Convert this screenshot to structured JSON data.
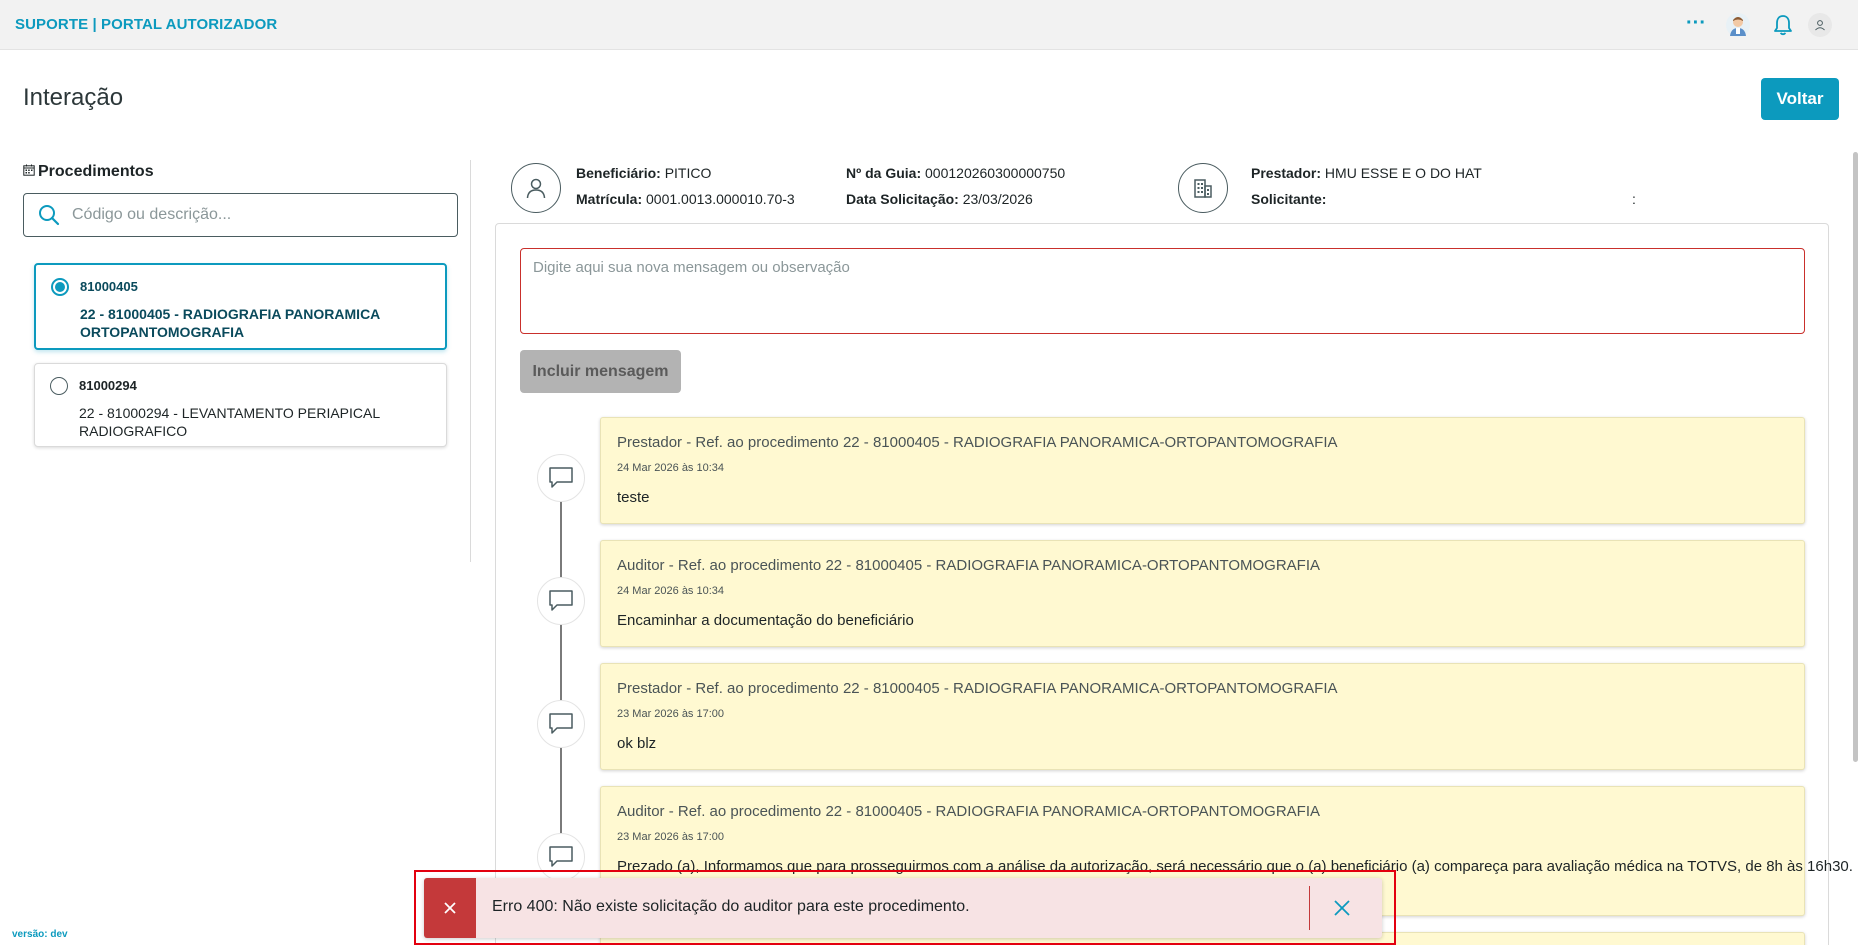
{
  "app": {
    "brand": "SUPORTE | PORTAL AUTORIZADOR",
    "more_label": "···",
    "version": "versão: dev"
  },
  "header": {
    "title": "Interação",
    "back_label": "Voltar"
  },
  "procedures": {
    "title": "Procedimentos",
    "search_placeholder": "Código ou descrição...",
    "items": [
      {
        "code": "81000405",
        "description": "22 - 81000405 - RADIOGRAFIA PANORAMICA ORTOPANTOMOGRAFIA",
        "selected": true
      },
      {
        "code": "81000294",
        "description": "22 - 81000294 - LEVANTAMENTO PERIAPICAL RADIOGRAFICO",
        "selected": false
      }
    ]
  },
  "info": {
    "beneficiario_label": "Beneficiário:",
    "beneficiario_value": "PITICO",
    "matricula_label": "Matrícula:",
    "matricula_value": "0001.0013.000010.70-3",
    "guia_label": "Nº da Guia:",
    "guia_value": "000120260300000750",
    "data_label": "Data Solicitação:",
    "data_value": "23/03/2026",
    "prestador_label": "Prestador:",
    "prestador_value": "HMU ESSE E O DO HAT",
    "solicitante_label": "Solicitante:",
    "solicitante_value": "",
    "solicitante_suffix": ":"
  },
  "composer": {
    "placeholder": "Digite aqui sua nova mensagem ou observação",
    "value": "",
    "submit_label": "Incluir mensagem"
  },
  "messages": [
    {
      "title": "Prestador - Ref. ao procedimento 22 - 81000405 - RADIOGRAFIA PANORAMICA-ORTOPANTOMOGRAFIA",
      "date": "24 Mar 2026 às 10:34",
      "body": "teste"
    },
    {
      "title": "Auditor - Ref. ao procedimento 22 - 81000405 - RADIOGRAFIA PANORAMICA-ORTOPANTOMOGRAFIA",
      "date": "24 Mar 2026 às 10:34",
      "body": "Encaminhar a documentação do beneficiário"
    },
    {
      "title": "Prestador - Ref. ao procedimento 22 - 81000405 - RADIOGRAFIA PANORAMICA-ORTOPANTOMOGRAFIA",
      "date": "23 Mar 2026 às 17:00",
      "body": "ok blz"
    },
    {
      "title": "Auditor - Ref. ao procedimento 22 - 81000405 - RADIOGRAFIA PANORAMICA-ORTOPANTOMOGRAFIA",
      "date": "23 Mar 2026 às 17:00",
      "body": "Prezado (a), Informamos que para prosseguirmos com a análise da autorização, será necessário que o (a) beneficiário (a) compareça para avaliação médica na TOTVS, de 8h às 16h30."
    }
  ],
  "toast": {
    "message": "Erro 400: Não existe solicitação do auditor para este procedimento."
  },
  "colors": {
    "primary": "#0c9abe",
    "error": "#c4393a",
    "error_bg": "#f7e3e4",
    "message_bg": "#fff9d1",
    "highlight": "#e3000f"
  },
  "icons": {
    "search": "search-icon",
    "calendar": "calendar-icon",
    "person": "person-icon",
    "building": "building-icon",
    "comment": "comment-icon",
    "close": "close-icon",
    "bell": "bell-icon",
    "user": "user-icon",
    "avatar": "avatar-icon"
  }
}
